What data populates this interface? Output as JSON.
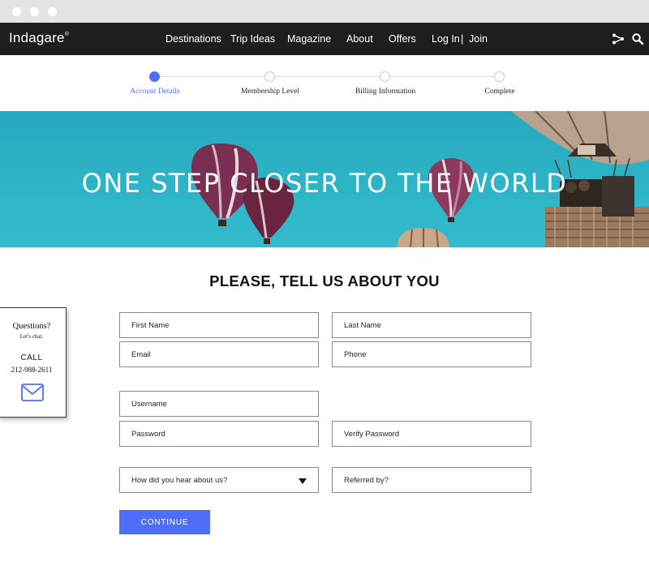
{
  "brand": {
    "name": "Indagare",
    "mark": "®"
  },
  "nav": {
    "links": [
      "Destinations",
      "Trip Ideas",
      "Magazine",
      "About",
      "Offers"
    ],
    "login": "Log In",
    "separator": "|",
    "join": "Join",
    "icons": [
      "share-icon",
      "search-icon"
    ]
  },
  "steps": [
    {
      "label": "Account Details",
      "active": true
    },
    {
      "label": "Membership Level",
      "active": false
    },
    {
      "label": "Billing Information",
      "active": false
    },
    {
      "label": "Complete",
      "active": false
    }
  ],
  "hero": {
    "title": "ONE STEP CLOSER TO THE WORLD"
  },
  "form": {
    "heading": "PLEASE, TELL US ABOUT YOU",
    "first_name": "First Name",
    "last_name": "Last Name",
    "email": "Email",
    "phone": "Phone",
    "username": "Username",
    "password": "Password",
    "verify_password": "Verify Password",
    "hear_about": "How did you hear about us?",
    "referred_by": "Referred by?",
    "continue_label": "CONTINUE"
  },
  "help": {
    "question": "Questions?",
    "chat": "Let's chat.",
    "call": "CALL",
    "phone": "212-988-2611",
    "icon": "mail-icon"
  },
  "colors": {
    "accent": "#4f6ef7",
    "nav_bg": "#1e1e1e",
    "sky": "#2ab2c6"
  }
}
